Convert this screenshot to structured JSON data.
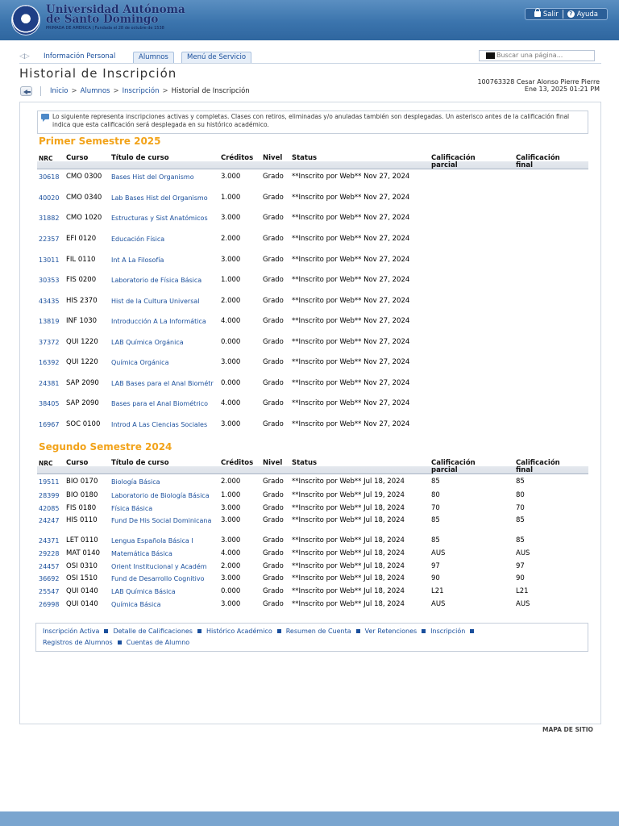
{
  "header": {
    "university_name_line1": "Universidad Autónoma",
    "university_name_line2": "de Santo Domingo",
    "university_tagline": "PRIMADA DE AMERICA | Fundada el 28 de octubre de 1538",
    "logout_label": "Salir",
    "help_label": "Ayuda"
  },
  "nav": {
    "items": [
      {
        "label": "Información Personal"
      },
      {
        "label": "Alumnos"
      },
      {
        "label": "Menú de Servicio"
      }
    ],
    "search_placeholder": "Buscar una página..."
  },
  "page": {
    "title": "Historial de Inscripción",
    "user_line": "100763328 Cesar Alonso Pierre Pierre",
    "datetime": "Ene 13, 2025 01:21 PM",
    "breadcrumb": [
      "Inicio",
      "Alumnos",
      "Inscripción",
      "Historial de Inscripción"
    ],
    "breadcrumb_sep": ">",
    "info_text": "Lo siguiente representa inscripciones activas y completas. Clases con retiros, eliminadas y/o anuladas también son desplegadas. Un asterisco antes de la calificación final indica que esta calificación será desplegada en su histórico académico."
  },
  "columns": {
    "nrc": "NRC",
    "curso": "Curso",
    "titulo": "Título de curso",
    "creditos": "Créditos",
    "nivel": "Nivel",
    "status": "Status",
    "parcial_1": "Calificación",
    "parcial_2": "parcial",
    "final_1": "Calificación",
    "final_2": "final"
  },
  "semesters": [
    {
      "title": "Primer Semestre 2025",
      "rows": [
        {
          "nrc": "30618",
          "curso": "CMO 0300",
          "titulo": "Bases Hist del Organismo",
          "creditos": "3.000",
          "nivel": "Grado",
          "status": "**Inscrito por Web** Nov 27, 2024",
          "parcial": "",
          "final": ""
        },
        {
          "nrc": "40020",
          "curso": "CMO 0340",
          "titulo": "Lab Bases Hist del Organismo",
          "creditos": "1.000",
          "nivel": "Grado",
          "status": "**Inscrito por Web** Nov 27, 2024",
          "parcial": "",
          "final": ""
        },
        {
          "nrc": "31882",
          "curso": "CMO 1020",
          "titulo": "Estructuras y Sist Anatómicos",
          "creditos": "3.000",
          "nivel": "Grado",
          "status": "**Inscrito por Web** Nov 27, 2024",
          "parcial": "",
          "final": ""
        },
        {
          "nrc": "22357",
          "curso": "EFI 0120",
          "titulo": "Educación Física",
          "creditos": "2.000",
          "nivel": "Grado",
          "status": "**Inscrito por Web** Nov 27, 2024",
          "parcial": "",
          "final": ""
        },
        {
          "nrc": "13011",
          "curso": "FIL 0110",
          "titulo": "Int A La Filosofía",
          "creditos": "3.000",
          "nivel": "Grado",
          "status": "**Inscrito por Web** Nov 27, 2024",
          "parcial": "",
          "final": ""
        },
        {
          "nrc": "30353",
          "curso": "FIS 0200",
          "titulo": "Laboratorio de Física Básica",
          "creditos": "1.000",
          "nivel": "Grado",
          "status": "**Inscrito por Web** Nov 27, 2024",
          "parcial": "",
          "final": ""
        },
        {
          "nrc": "43435",
          "curso": "HIS 2370",
          "titulo": "Hist de la Cultura Universal",
          "creditos": "2.000",
          "nivel": "Grado",
          "status": "**Inscrito por Web** Nov 27, 2024",
          "parcial": "",
          "final": ""
        },
        {
          "nrc": "13819",
          "curso": "INF 1030",
          "titulo": "Introducción A La Informática",
          "creditos": "4.000",
          "nivel": "Grado",
          "status": "**Inscrito por Web** Nov 27, 2024",
          "parcial": "",
          "final": ""
        },
        {
          "nrc": "37372",
          "curso": "QUI 1220",
          "titulo": "LAB Química Orgánica",
          "creditos": "0.000",
          "nivel": "Grado",
          "status": "**Inscrito por Web** Nov 27, 2024",
          "parcial": "",
          "final": ""
        },
        {
          "nrc": "16392",
          "curso": "QUI 1220",
          "titulo": "Química Orgánica",
          "creditos": "3.000",
          "nivel": "Grado",
          "status": "**Inscrito por Web** Nov 27, 2024",
          "parcial": "",
          "final": ""
        },
        {
          "nrc": "24381",
          "curso": "SAP 2090",
          "titulo": "LAB Bases para el Anal Biométr",
          "creditos": "0.000",
          "nivel": "Grado",
          "status": "**Inscrito por Web** Nov 27, 2024",
          "parcial": "",
          "final": ""
        },
        {
          "nrc": "38405",
          "curso": "SAP 2090",
          "titulo": "Bases para el Anal Biométrico",
          "creditos": "4.000",
          "nivel": "Grado",
          "status": "**Inscrito por Web** Nov 27, 2024",
          "parcial": "",
          "final": ""
        },
        {
          "nrc": "16967",
          "curso": "SOC 0100",
          "titulo": "Introd A Las Ciencias Sociales",
          "creditos": "3.000",
          "nivel": "Grado",
          "status": "**Inscrito por Web** Nov 27, 2024",
          "parcial": "",
          "final": ""
        }
      ]
    },
    {
      "title": "Segundo Semestre 2024",
      "rows": [
        {
          "nrc": "19511",
          "curso": "BIO 0170",
          "titulo": "Biología Básica",
          "creditos": "2.000",
          "nivel": "Grado",
          "status": "**Inscrito por Web** Jul 18, 2024",
          "parcial": "85",
          "final": "85"
        },
        {
          "nrc": "28399",
          "curso": "BIO 0180",
          "titulo": "Laboratorio de Biología Básica",
          "creditos": "1.000",
          "nivel": "Grado",
          "status": "**Inscrito por Web** Jul 19, 2024",
          "parcial": "80",
          "final": "80"
        },
        {
          "nrc": "42085",
          "curso": "FIS 0180",
          "titulo": "Física Básica",
          "creditos": "3.000",
          "nivel": "Grado",
          "status": "**Inscrito por Web** Jul 18, 2024",
          "parcial": "70",
          "final": "70"
        },
        {
          "nrc": "24247",
          "curso": "HIS 0110",
          "titulo": "Fund De His Social Dominicana",
          "creditos": "3.000",
          "nivel": "Grado",
          "status": "**Inscrito por Web** Jul 18, 2024",
          "parcial": "85",
          "final": "85"
        },
        {
          "nrc": "24371",
          "curso": "LET 0110",
          "titulo": "Lengua Española Básica I",
          "creditos": "3.000",
          "nivel": "Grado",
          "status": "**Inscrito por Web** Jul 18, 2024",
          "parcial": "85",
          "final": "85"
        },
        {
          "nrc": "29228",
          "curso": "MAT 0140",
          "titulo": "Matemática Básica",
          "creditos": "4.000",
          "nivel": "Grado",
          "status": "**Inscrito por Web** Jul 18, 2024",
          "parcial": "AUS",
          "final": "AUS"
        },
        {
          "nrc": "24457",
          "curso": "OSI 0310",
          "titulo": "Orient Institucional y Académ",
          "creditos": "2.000",
          "nivel": "Grado",
          "status": "**Inscrito por Web** Jul 18, 2024",
          "parcial": "97",
          "final": "97"
        },
        {
          "nrc": "36692",
          "curso": "OSI 1510",
          "titulo": "Fund de Desarrollo Cognitivo",
          "creditos": "3.000",
          "nivel": "Grado",
          "status": "**Inscrito por Web** Jul 18, 2024",
          "parcial": "90",
          "final": "90"
        },
        {
          "nrc": "25547",
          "curso": "QUI 0140",
          "titulo": "LAB Química Básica",
          "creditos": "0.000",
          "nivel": "Grado",
          "status": "**Inscrito por Web** Jul 18, 2024",
          "parcial": "L21",
          "final": "L21"
        },
        {
          "nrc": "26998",
          "curso": "QUI 0140",
          "titulo": "Química Básica",
          "creditos": "3.000",
          "nivel": "Grado",
          "status": "**Inscrito por Web** Jul 18, 2024",
          "parcial": "AUS",
          "final": "AUS"
        }
      ]
    }
  ],
  "footer": {
    "links": [
      {
        "label": "Inscripción Activa"
      },
      {
        "label": "Detalle de Calificaciones"
      },
      {
        "label": "Histórico Académico"
      },
      {
        "label": "Resumen de Cuenta"
      },
      {
        "label": "Ver Retenciones"
      },
      {
        "label": "Inscripción"
      },
      {
        "label": "Registros de Alumnos"
      },
      {
        "label": "Cuentas de Alumno"
      }
    ],
    "sitemap": "MAPA DE SITIO"
  },
  "colors": {
    "banner": "#3b74ad",
    "link": "#1a4f9c",
    "semester_title": "#f2a31a"
  },
  "icons": [
    "university-seal",
    "lock-icon",
    "help-icon",
    "back-arrow-icon",
    "info-icon",
    "search-icon"
  ]
}
